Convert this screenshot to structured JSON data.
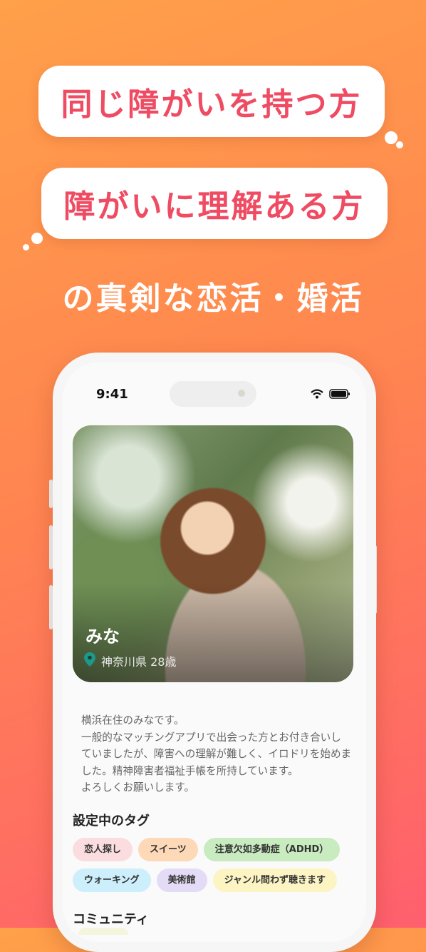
{
  "headline": {
    "line1": "同じ障がいを持つ方",
    "line2": "障がいに理解ある方",
    "tagline": "の真剣な恋活・婚活"
  },
  "status_bar": {
    "time": "9:41"
  },
  "profile": {
    "name": "みな",
    "location": "神奈川県 28歳",
    "bio": "横浜在住のみなです。\n一般的なマッチングアプリで出会った方とお付き合いし\nていましたが、障害への理解が難しく、イロドリを始めま\nした。精神障害者福祉手帳を所持しています。\nよろしくお願いします。"
  },
  "tags_section": {
    "title": "設定中のタグ",
    "tags": [
      {
        "label": "恋人探し",
        "color": "#fbdde0"
      },
      {
        "label": "スイーツ",
        "color": "#fdd9b8"
      },
      {
        "label": "注意欠如多動症（ADHD）",
        "color": "#c8ebc0"
      },
      {
        "label": "ウォーキング",
        "color": "#cdeefb"
      },
      {
        "label": "美術館",
        "color": "#e4dcf6"
      },
      {
        "label": "ジャンル問わず聴きます",
        "color": "#fdf4c4"
      }
    ]
  },
  "community_section": {
    "title": "コミュニティ"
  },
  "colors": {
    "accent": "#ef4b62",
    "location_pin": "#1a9a8a"
  }
}
